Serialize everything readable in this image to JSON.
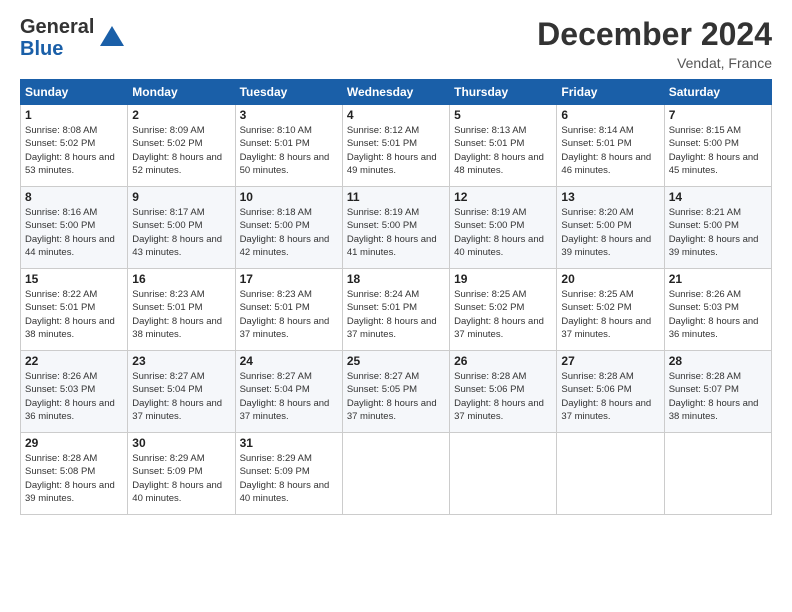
{
  "header": {
    "logo_general": "General",
    "logo_blue": "Blue",
    "title": "December 2024",
    "location": "Vendat, France"
  },
  "weekdays": [
    "Sunday",
    "Monday",
    "Tuesday",
    "Wednesday",
    "Thursday",
    "Friday",
    "Saturday"
  ],
  "weeks": [
    [
      {
        "day": "1",
        "sunrise": "8:08 AM",
        "sunset": "5:02 PM",
        "daylight": "8 hours and 53 minutes."
      },
      {
        "day": "2",
        "sunrise": "8:09 AM",
        "sunset": "5:02 PM",
        "daylight": "8 hours and 52 minutes."
      },
      {
        "day": "3",
        "sunrise": "8:10 AM",
        "sunset": "5:01 PM",
        "daylight": "8 hours and 50 minutes."
      },
      {
        "day": "4",
        "sunrise": "8:12 AM",
        "sunset": "5:01 PM",
        "daylight": "8 hours and 49 minutes."
      },
      {
        "day": "5",
        "sunrise": "8:13 AM",
        "sunset": "5:01 PM",
        "daylight": "8 hours and 48 minutes."
      },
      {
        "day": "6",
        "sunrise": "8:14 AM",
        "sunset": "5:01 PM",
        "daylight": "8 hours and 46 minutes."
      },
      {
        "day": "7",
        "sunrise": "8:15 AM",
        "sunset": "5:00 PM",
        "daylight": "8 hours and 45 minutes."
      }
    ],
    [
      {
        "day": "8",
        "sunrise": "8:16 AM",
        "sunset": "5:00 PM",
        "daylight": "8 hours and 44 minutes."
      },
      {
        "day": "9",
        "sunrise": "8:17 AM",
        "sunset": "5:00 PM",
        "daylight": "8 hours and 43 minutes."
      },
      {
        "day": "10",
        "sunrise": "8:18 AM",
        "sunset": "5:00 PM",
        "daylight": "8 hours and 42 minutes."
      },
      {
        "day": "11",
        "sunrise": "8:19 AM",
        "sunset": "5:00 PM",
        "daylight": "8 hours and 41 minutes."
      },
      {
        "day": "12",
        "sunrise": "8:19 AM",
        "sunset": "5:00 PM",
        "daylight": "8 hours and 40 minutes."
      },
      {
        "day": "13",
        "sunrise": "8:20 AM",
        "sunset": "5:00 PM",
        "daylight": "8 hours and 39 minutes."
      },
      {
        "day": "14",
        "sunrise": "8:21 AM",
        "sunset": "5:00 PM",
        "daylight": "8 hours and 39 minutes."
      }
    ],
    [
      {
        "day": "15",
        "sunrise": "8:22 AM",
        "sunset": "5:01 PM",
        "daylight": "8 hours and 38 minutes."
      },
      {
        "day": "16",
        "sunrise": "8:23 AM",
        "sunset": "5:01 PM",
        "daylight": "8 hours and 38 minutes."
      },
      {
        "day": "17",
        "sunrise": "8:23 AM",
        "sunset": "5:01 PM",
        "daylight": "8 hours and 37 minutes."
      },
      {
        "day": "18",
        "sunrise": "8:24 AM",
        "sunset": "5:01 PM",
        "daylight": "8 hours and 37 minutes."
      },
      {
        "day": "19",
        "sunrise": "8:25 AM",
        "sunset": "5:02 PM",
        "daylight": "8 hours and 37 minutes."
      },
      {
        "day": "20",
        "sunrise": "8:25 AM",
        "sunset": "5:02 PM",
        "daylight": "8 hours and 37 minutes."
      },
      {
        "day": "21",
        "sunrise": "8:26 AM",
        "sunset": "5:03 PM",
        "daylight": "8 hours and 36 minutes."
      }
    ],
    [
      {
        "day": "22",
        "sunrise": "8:26 AM",
        "sunset": "5:03 PM",
        "daylight": "8 hours and 36 minutes."
      },
      {
        "day": "23",
        "sunrise": "8:27 AM",
        "sunset": "5:04 PM",
        "daylight": "8 hours and 37 minutes."
      },
      {
        "day": "24",
        "sunrise": "8:27 AM",
        "sunset": "5:04 PM",
        "daylight": "8 hours and 37 minutes."
      },
      {
        "day": "25",
        "sunrise": "8:27 AM",
        "sunset": "5:05 PM",
        "daylight": "8 hours and 37 minutes."
      },
      {
        "day": "26",
        "sunrise": "8:28 AM",
        "sunset": "5:06 PM",
        "daylight": "8 hours and 37 minutes."
      },
      {
        "day": "27",
        "sunrise": "8:28 AM",
        "sunset": "5:06 PM",
        "daylight": "8 hours and 37 minutes."
      },
      {
        "day": "28",
        "sunrise": "8:28 AM",
        "sunset": "5:07 PM",
        "daylight": "8 hours and 38 minutes."
      }
    ],
    [
      {
        "day": "29",
        "sunrise": "8:28 AM",
        "sunset": "5:08 PM",
        "daylight": "8 hours and 39 minutes."
      },
      {
        "day": "30",
        "sunrise": "8:29 AM",
        "sunset": "5:09 PM",
        "daylight": "8 hours and 40 minutes."
      },
      {
        "day": "31",
        "sunrise": "8:29 AM",
        "sunset": "5:09 PM",
        "daylight": "8 hours and 40 minutes."
      },
      null,
      null,
      null,
      null
    ]
  ]
}
